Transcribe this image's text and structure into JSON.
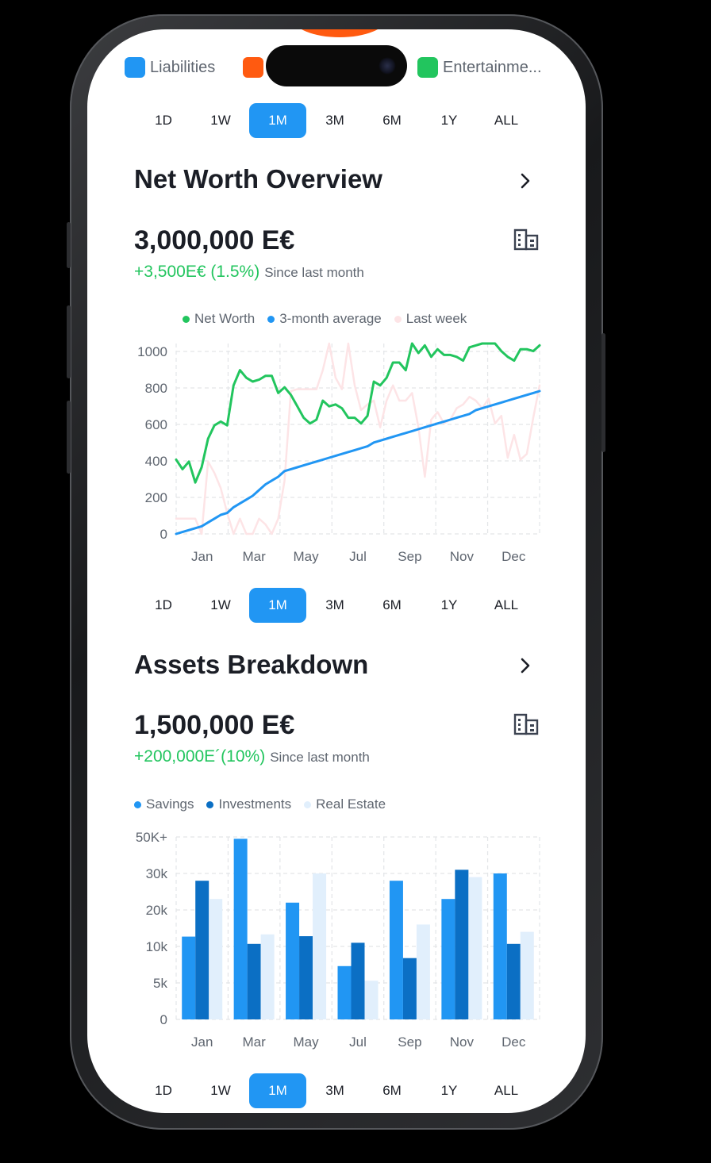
{
  "legend_top": [
    {
      "label": "Liabilities",
      "color": "#2196f3"
    },
    {
      "label": "",
      "color": "#ff5a10"
    },
    {
      "label": "Entertainme...",
      "color": "#22c55e"
    }
  ],
  "timeframes": [
    "1D",
    "1W",
    "1M",
    "3M",
    "6M",
    "1Y",
    "ALL"
  ],
  "active_timeframe": "1M",
  "net_worth": {
    "title": "Net Worth Overview",
    "amount": "3,000,000 E€",
    "change": "+3,500E€ (1.5%)",
    "since": "Since last month",
    "legend": [
      {
        "label": "Net Worth",
        "color": "#22c55e"
      },
      {
        "label": "3-month average",
        "color": "#2196f3"
      },
      {
        "label": "Last week",
        "color": "#fde4e6"
      }
    ]
  },
  "assets": {
    "title": "Assets Breakdown",
    "amount": "1,500,000 E€",
    "change": "+200,000E´(10%)",
    "since": "Since last month",
    "legend": [
      {
        "label": "Savings",
        "color": "#2196f3"
      },
      {
        "label": "Investments",
        "color": "#0b6fc4"
      },
      {
        "label": "Real Estate",
        "color": "#e1effc"
      }
    ]
  },
  "chart_data": [
    {
      "type": "line",
      "x_tick_labels": [
        "Jan",
        "Mar",
        "May",
        "Jul",
        "Sep",
        "Nov",
        "Dec"
      ],
      "y_tick_labels": [
        "0",
        "200",
        "400",
        "600",
        "800",
        "1000"
      ],
      "ylim": [
        0,
        1000
      ],
      "grid": true,
      "legend_position": "top",
      "series": [
        {
          "name": "Net Worth",
          "color": "#22c55e",
          "values": [
            390,
            340,
            380,
            270,
            350,
            500,
            570,
            590,
            570,
            780,
            860,
            820,
            800,
            810,
            830,
            830,
            740,
            770,
            730,
            670,
            610,
            580,
            600,
            700,
            670,
            680,
            660,
            610,
            610,
            580,
            620,
            800,
            780,
            820,
            900,
            900,
            860,
            1000,
            950,
            990,
            930,
            970,
            940,
            940,
            930,
            910,
            980,
            990,
            1040,
            1000,
            1010,
            960,
            930,
            910,
            970,
            970,
            960,
            990
          ]
        },
        {
          "name": "3-month average",
          "color": "#2196f3",
          "values": [
            0,
            10,
            20,
            30,
            40,
            60,
            80,
            100,
            110,
            140,
            160,
            180,
            200,
            230,
            260,
            280,
            300,
            330,
            340,
            350,
            360,
            370,
            380,
            390,
            400,
            410,
            420,
            430,
            440,
            450,
            460,
            480,
            490,
            500,
            510,
            520,
            530,
            540,
            550,
            560,
            570,
            580,
            590,
            600,
            610,
            620,
            630,
            650,
            660,
            670,
            680,
            690,
            700,
            710,
            720,
            730,
            740,
            750
          ]
        },
        {
          "name": "Last week",
          "color": "#fde4e6",
          "values": [
            80,
            80,
            80,
            80,
            0,
            380,
            320,
            240,
            110,
            0,
            80,
            0,
            0,
            80,
            50,
            0,
            80,
            280,
            750,
            760,
            760,
            760,
            760,
            860,
            1000,
            820,
            760,
            1040,
            780,
            650,
            680,
            700,
            560,
            700,
            780,
            700,
            700,
            740,
            560,
            300,
            600,
            640,
            580,
            600,
            660,
            680,
            720,
            700,
            660,
            710,
            580,
            620,
            400,
            520,
            390,
            420,
            610,
            780
          ]
        }
      ]
    },
    {
      "type": "bar",
      "categories": [
        "Jan",
        "Mar",
        "May",
        "Jul",
        "Sep",
        "Nov",
        "Dec"
      ],
      "y_tick_labels": [
        "0",
        "5k",
        "10k",
        "20k",
        "30k",
        "50K+"
      ],
      "grid": true,
      "legend_position": "top",
      "series": [
        {
          "name": "Savings",
          "color": "#2196f3",
          "values": [
            12.7,
            49,
            22,
            7.3,
            28,
            23,
            30
          ]
        },
        {
          "name": "Investments",
          "color": "#0b6fc4",
          "values": [
            28,
            10.7,
            12.8,
            11,
            8.4,
            32,
            10.7
          ]
        },
        {
          "name": "Real Estate",
          "color": "#e1effc",
          "values": [
            23,
            13.3,
            30,
            5.3,
            16,
            29,
            14
          ]
        }
      ]
    }
  ]
}
